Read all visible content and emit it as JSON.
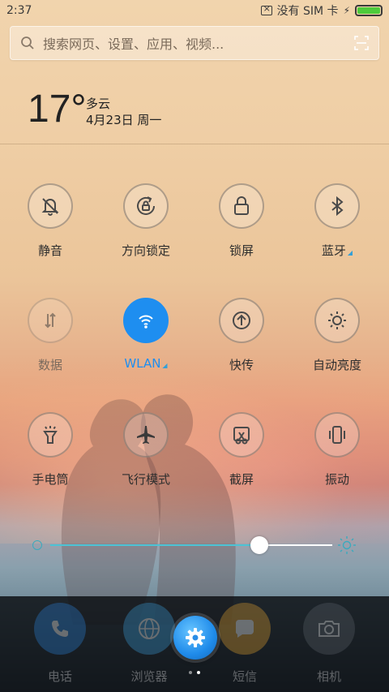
{
  "status_bar": {
    "time": "2:37",
    "sim_status": "没有 SIM 卡"
  },
  "search": {
    "placeholder": "搜索网页、设置、应用、视频..."
  },
  "weather": {
    "temperature": "17°",
    "condition": "多云",
    "date": "4月23日 周一"
  },
  "toggles": [
    {
      "id": "mute",
      "label": "静音",
      "icon": "bell-off-icon",
      "state": "off"
    },
    {
      "id": "rotation-lock",
      "label": "方向锁定",
      "icon": "rotation-lock-icon",
      "state": "off"
    },
    {
      "id": "lock-screen",
      "label": "锁屏",
      "icon": "lock-icon",
      "state": "off"
    },
    {
      "id": "bluetooth",
      "label": "蓝牙",
      "icon": "bluetooth-icon",
      "state": "off",
      "has_more": true
    },
    {
      "id": "data",
      "label": "数据",
      "icon": "data-arrows-icon",
      "state": "disabled"
    },
    {
      "id": "wlan",
      "label": "WLAN",
      "icon": "wifi-icon",
      "state": "on",
      "has_more": true
    },
    {
      "id": "quick-transfer",
      "label": "快传",
      "icon": "upload-arrow-icon",
      "state": "off"
    },
    {
      "id": "auto-brightness",
      "label": "自动亮度",
      "icon": "sun-icon",
      "state": "off"
    },
    {
      "id": "flashlight",
      "label": "手电筒",
      "icon": "flashlight-icon",
      "state": "off"
    },
    {
      "id": "airplane",
      "label": "飞行模式",
      "icon": "airplane-icon",
      "state": "off"
    },
    {
      "id": "screenshot",
      "label": "截屏",
      "icon": "scissors-icon",
      "state": "off"
    },
    {
      "id": "vibrate",
      "label": "振动",
      "icon": "vibrate-icon",
      "state": "off"
    }
  ],
  "brightness": {
    "level": 0.74
  },
  "dock": [
    {
      "label": "电话",
      "icon": "phone-icon"
    },
    {
      "label": "浏览器",
      "icon": "globe-icon"
    },
    {
      "label": "短信",
      "icon": "message-icon"
    },
    {
      "label": "相机",
      "icon": "camera-icon"
    }
  ],
  "colors": {
    "accent": "#1e8ef0",
    "slider": "#4dc3d4",
    "battery": "#4ecb3c"
  }
}
